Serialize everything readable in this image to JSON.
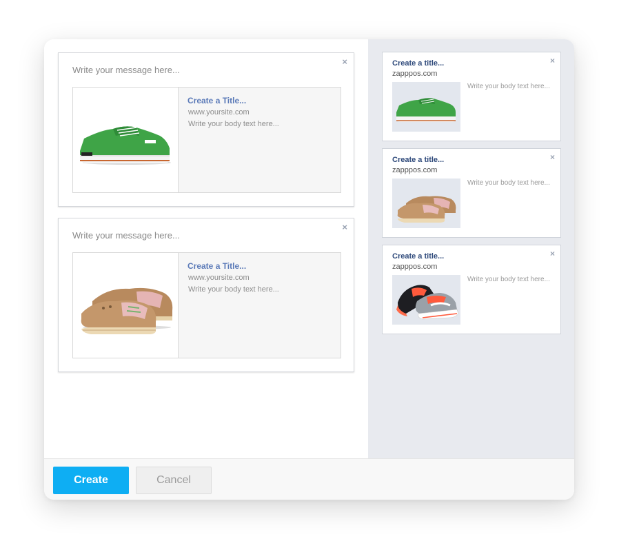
{
  "composer": {
    "cards": [
      {
        "message_placeholder": "Write your message here...",
        "preview_title": "Create a Title...",
        "preview_url": "www.yoursite.com",
        "preview_body": "Write your body text here...",
        "image": "green-sneaker",
        "close_glyph": "×"
      },
      {
        "message_placeholder": "Write your message here...",
        "preview_title": "Create a Title...",
        "preview_url": "www.yoursite.com",
        "preview_body": "Write your body text here...",
        "image": "boat-shoes",
        "close_glyph": "×"
      }
    ]
  },
  "ads": {
    "cards": [
      {
        "title": "Create a title...",
        "domain": "zapppos.com",
        "body": "Write your body text here...",
        "image": "green-sneaker",
        "close_glyph": "×"
      },
      {
        "title": "Create a title...",
        "domain": "zapppos.com",
        "body": "Write your body text here...",
        "image": "boat-shoes",
        "close_glyph": "×"
      },
      {
        "title": "Create a title...",
        "domain": "zapppos.com",
        "body": "Write your body text here...",
        "image": "running-shoes",
        "close_glyph": "×"
      }
    ]
  },
  "footer": {
    "create_label": "Create",
    "cancel_label": "Cancel"
  },
  "colors": {
    "accent": "#0eaef3",
    "link_title": "#5b7ab8",
    "ad_title": "#2f4a7b",
    "side_panel": "#e8eaef"
  }
}
